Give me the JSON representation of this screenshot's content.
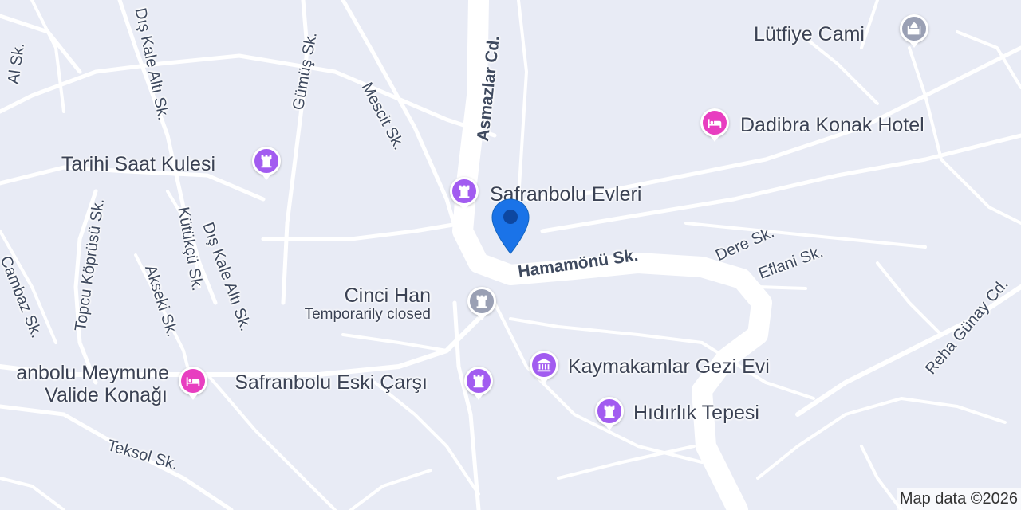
{
  "map": {
    "background_color": "#e8ebf5",
    "road_color": "#ffffff",
    "attribution": "Map data ©2026"
  },
  "streets": [
    {
      "id": "al",
      "label": "Al Sk."
    },
    {
      "id": "dis-kale-alti-1",
      "label": "Dış Kale Altı Sk."
    },
    {
      "id": "gumus",
      "label": "Gümüş Sk."
    },
    {
      "id": "mescit",
      "label": "Mescit Sk."
    },
    {
      "id": "asmazlar",
      "label": "Asmazlar Cd."
    },
    {
      "id": "topcu-koprusu",
      "label": "Topcu Köprüsü Sk."
    },
    {
      "id": "kutukcu",
      "label": "Kütükçü Sk."
    },
    {
      "id": "dis-kale-alti-2",
      "label": "Dış Kale Altı Sk."
    },
    {
      "id": "cambaz",
      "label": "Cambaz Sk."
    },
    {
      "id": "akseki",
      "label": "Akseki Sk."
    },
    {
      "id": "hamamonu",
      "label": "Hamamönü Sk."
    },
    {
      "id": "dere",
      "label": "Dere Sk."
    },
    {
      "id": "eflani",
      "label": "Eflani Sk."
    },
    {
      "id": "reha-gunay",
      "label": "Reha Günay Cd."
    },
    {
      "id": "teksol",
      "label": "Teksol Sk."
    }
  ],
  "places": [
    {
      "id": "lutfiye-cami",
      "label": "Lütfiye Cami",
      "icon": "mosque-icon",
      "color": "#9aa0b4"
    },
    {
      "id": "dadibra",
      "label": "Dadibra Konak Hotel",
      "icon": "bed-icon",
      "color": "#e83ec0"
    },
    {
      "id": "tarihi-saat",
      "label": "Tarihi Saat Kulesi",
      "icon": "castle-icon",
      "color": "#a25cf0"
    },
    {
      "id": "safranbolu-evleri",
      "label": "Safranbolu Evleri",
      "icon": "castle-icon",
      "color": "#a25cf0"
    },
    {
      "id": "cinci-han",
      "label": "Cinci Han",
      "sub": "Temporarily closed",
      "icon": "castle-icon",
      "color": "#9aa0b4"
    },
    {
      "id": "kaymakamlar",
      "label": "Kaymakamlar Gezi Evi",
      "icon": "museum-icon",
      "color": "#a25cf0"
    },
    {
      "id": "eski-carsi",
      "label": "Safranbolu Eski Çarşı",
      "icon": "castle-icon",
      "color": "#a25cf0"
    },
    {
      "id": "hidirlik",
      "label": "Hıdırlık Tepesi",
      "icon": "castle-icon",
      "color": "#a25cf0"
    },
    {
      "id": "meymune",
      "label": "anbolu Meymune",
      "label2": "Valide Konağı",
      "icon": "bed-icon",
      "color": "#e83ec0"
    }
  ],
  "marker": {
    "color": "#1a73e8",
    "center_color": "#0d47a1"
  }
}
